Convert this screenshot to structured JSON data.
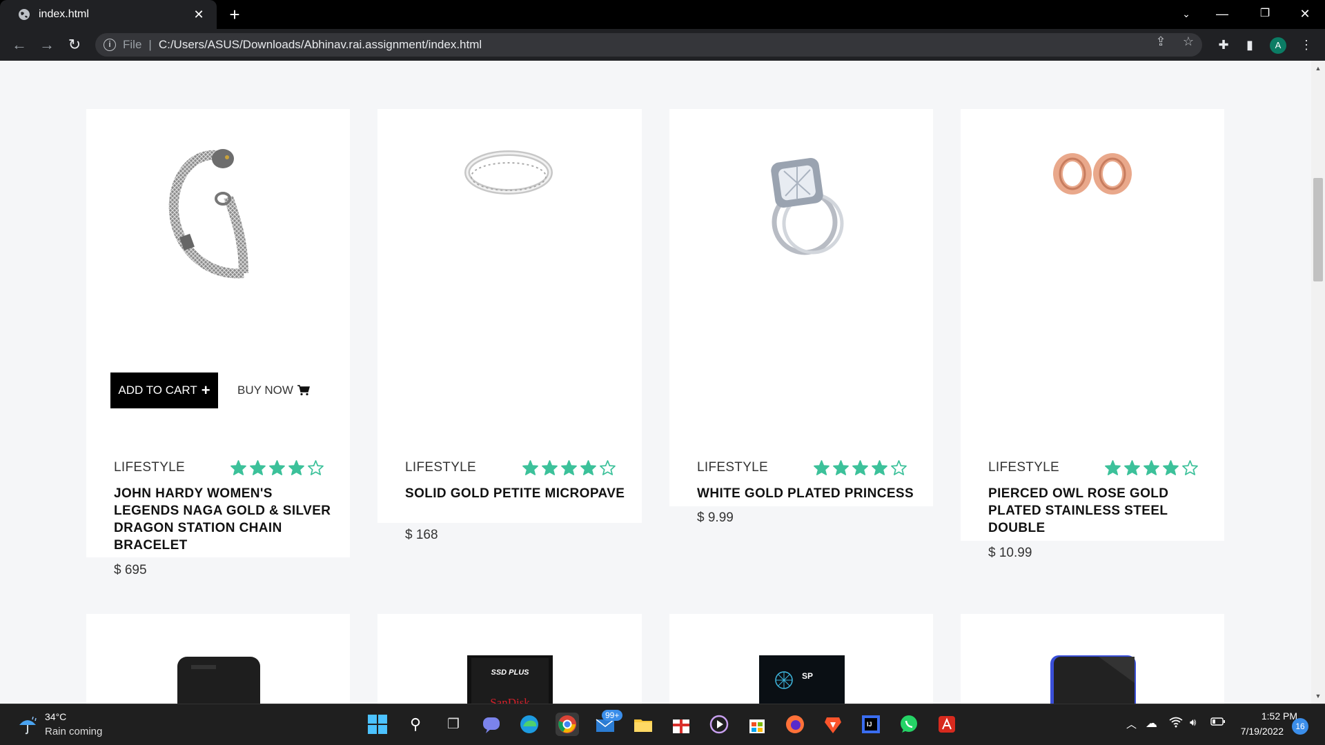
{
  "browser": {
    "tab_title": "index.html",
    "close_tab_symbol": "✕",
    "new_tab_symbol": "+",
    "address_scheme": "File",
    "address_separator": "|",
    "address_url": "C:/Users/ASUS/Downloads/Abhinav.rai.assignment/index.html",
    "profile_initial": "A"
  },
  "products_row1": [
    {
      "category": "LIFESTYLE",
      "title": "JOHN HARDY WOMEN'S LEGENDS NAGA GOLD & SILVER DRAGON STATION CHAIN BRACELET",
      "price": "$ 695",
      "rating": 4,
      "max_rating": 5,
      "image": "bracelet"
    },
    {
      "category": "LIFESTYLE",
      "title": "SOLID GOLD PETITE MICROPAVE",
      "price": "$ 168",
      "rating": 4,
      "max_rating": 5,
      "image": "ring"
    },
    {
      "category": "LIFESTYLE",
      "title": "WHITE GOLD PLATED PRINCESS",
      "price": "$ 9.99",
      "rating": 4,
      "max_rating": 5,
      "image": "diamond-ring"
    },
    {
      "category": "LIFESTYLE",
      "title": "PIERCED OWL ROSE GOLD PLATED STAINLESS STEEL DOUBLE",
      "price": "$ 10.99",
      "rating": 4,
      "max_rating": 5,
      "image": "rose-gold-plugs"
    }
  ],
  "hover_actions": {
    "add_to_cart": "ADD TO CART",
    "buy_now": "BUY NOW"
  },
  "products_row2_images": [
    "external-hard-drive",
    "ssd-sandisk",
    "ssd-silicon-power",
    "external-ssd-blue"
  ],
  "ssd_labels": {
    "sandisk_top": "SSD PLUS",
    "sandisk_brand": "SanDisk",
    "sp_brand": "SP"
  },
  "taskbar": {
    "weather_temp": "34°C",
    "weather_desc": "Rain coming",
    "mail_badge": "99+",
    "time": "1:52 PM",
    "date": "7/19/2022",
    "notification_count": "16"
  },
  "colors": {
    "star": "#3cc19a",
    "page_bg": "#f5f6f8",
    "browser_dark": "#202124"
  }
}
